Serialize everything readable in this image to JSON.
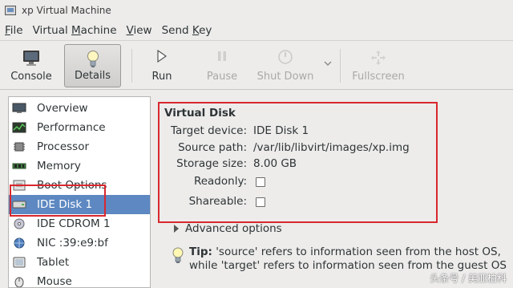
{
  "window": {
    "title": "xp Virtual Machine"
  },
  "menubar": {
    "items": [
      {
        "label": "File",
        "mnemonic": "F",
        "rest": "ile"
      },
      {
        "label": "Virtual Machine",
        "mnemonic": "M",
        "before": "Virtual ",
        "rest": "achine"
      },
      {
        "label": "View",
        "mnemonic": "V",
        "rest": "iew"
      },
      {
        "label": "Send Key",
        "mnemonic": "K",
        "before": "Send ",
        "rest": "ey"
      }
    ]
  },
  "toolbar": {
    "console": "Console",
    "details": "Details",
    "run": "Run",
    "pause": "Pause",
    "shutdown": "Shut Down",
    "fullscreen": "Fullscreen"
  },
  "sidebar": {
    "items": [
      {
        "label": "Overview",
        "icon": "overview-icon"
      },
      {
        "label": "Performance",
        "icon": "performance-icon"
      },
      {
        "label": "Processor",
        "icon": "processor-icon"
      },
      {
        "label": "Memory",
        "icon": "memory-icon"
      },
      {
        "label": "Boot Options",
        "icon": "boot-options-icon"
      },
      {
        "label": "IDE Disk 1",
        "icon": "disk-icon",
        "selected": true
      },
      {
        "label": "IDE CDROM 1",
        "icon": "cdrom-icon"
      },
      {
        "label": "NIC :39:e9:bf",
        "icon": "nic-icon"
      },
      {
        "label": "Tablet",
        "icon": "tablet-icon"
      },
      {
        "label": "Mouse",
        "icon": "mouse-icon"
      }
    ]
  },
  "details": {
    "section_title": "Virtual Disk",
    "target_device_label": "Target device:",
    "target_device_value": "IDE Disk 1",
    "source_path_label": "Source path:",
    "source_path_value": "/var/lib/libvirt/images/xp.img",
    "storage_size_label": "Storage size:",
    "storage_size_value": "8.00 GB",
    "readonly_label": "Readonly:",
    "readonly_checked": false,
    "shareable_label": "Shareable:",
    "shareable_checked": false,
    "advanced_options": "Advanced options",
    "tip_label": "Tip:",
    "tip_text_line1": "'source' refers to information seen from the host OS,",
    "tip_text_line2": "while 'target' refers to information seen from the guest OS"
  },
  "watermark": "头条号 / 美亚柏科",
  "colors": {
    "selection": "#5d88c1",
    "annotation_red": "#d9272e",
    "background": "#edeceb"
  }
}
